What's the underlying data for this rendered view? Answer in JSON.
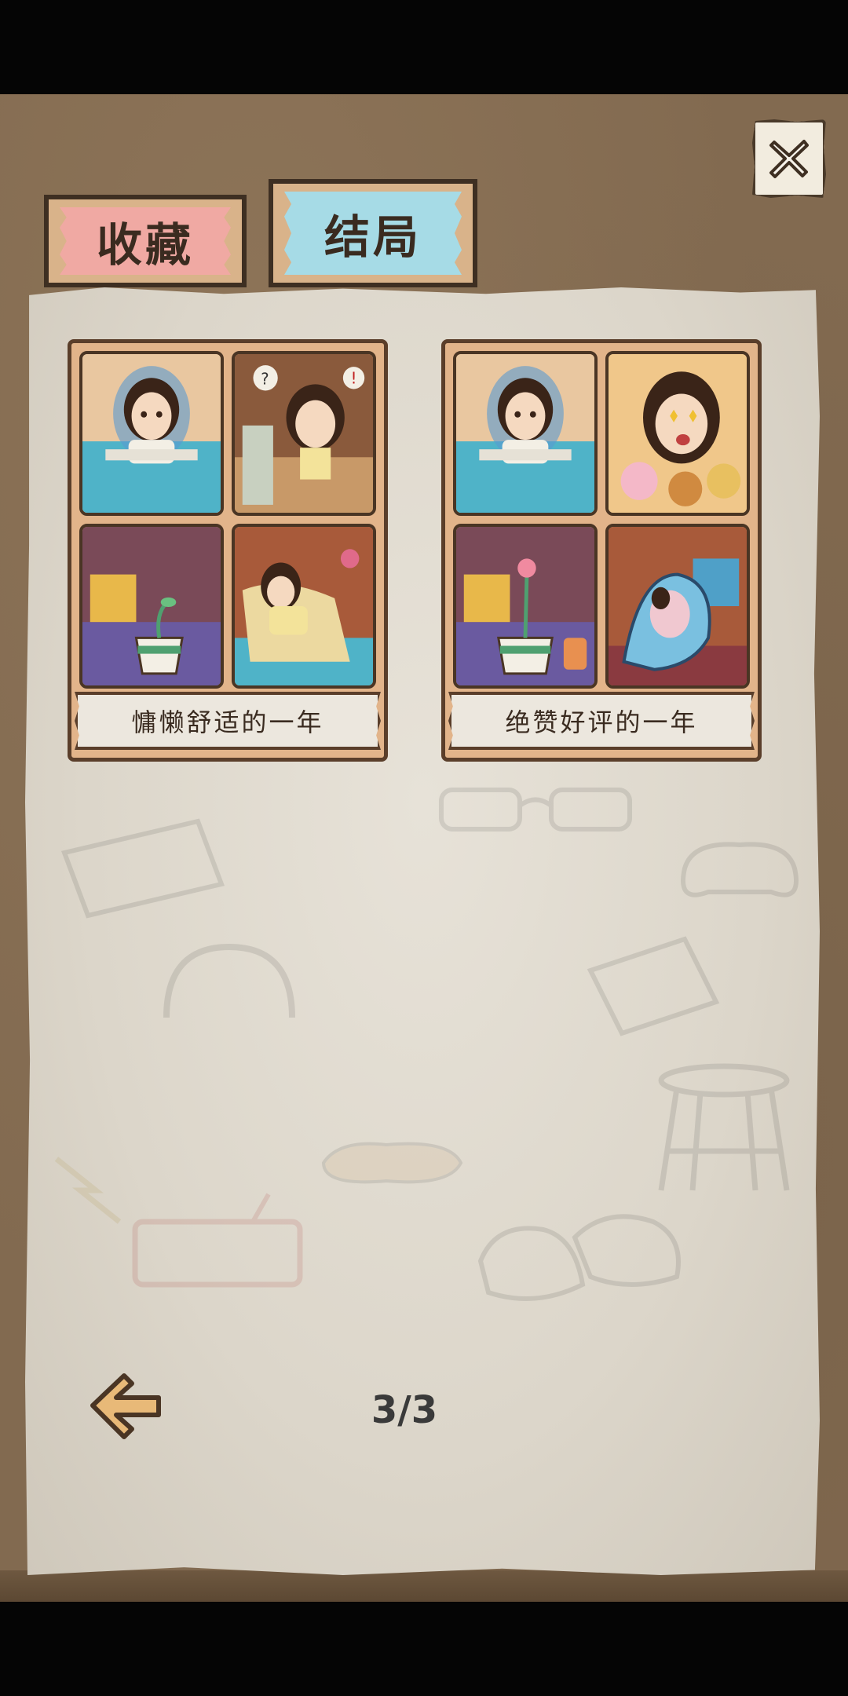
{
  "tabs": {
    "collection_label": "收藏",
    "endings_label": "结局",
    "active": "endings"
  },
  "endings": [
    {
      "title": "慵懒舒适的一年"
    },
    {
      "title": "绝赞好评的一年"
    }
  ],
  "pagination": {
    "current": 3,
    "total": 3,
    "label": "3/3"
  },
  "icons": {
    "close": "close-icon",
    "back": "back-arrow-icon"
  },
  "colors": {
    "board": "#826a50",
    "paper": "#dcd6ca",
    "tab_collection": "#f0a9a3",
    "tab_endings": "#a6dbe6",
    "card_frame": "#e2b48a"
  }
}
